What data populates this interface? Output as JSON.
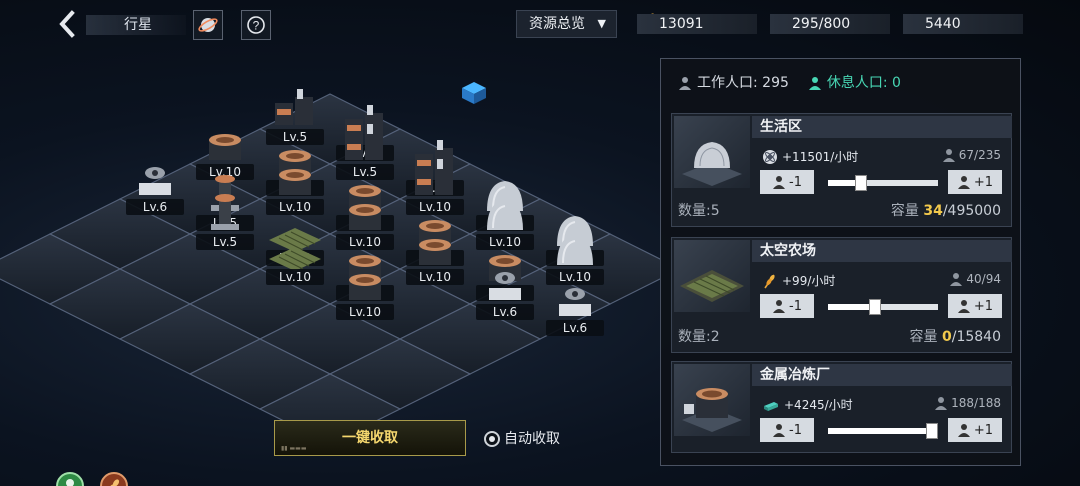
{
  "header": {
    "planet_title": "行星",
    "resources_overview": "资源总览",
    "resources": [
      {
        "name": "energy",
        "icon": "wheat-icon",
        "value": "13091"
      },
      {
        "name": "population",
        "icon": "population-icon",
        "value": "295/800"
      },
      {
        "name": "metal",
        "icon": "metal-bars-icon",
        "value": "5440"
      }
    ]
  },
  "map": {
    "collect_all_label": "一键收取",
    "auto_collect_label": "自动收取",
    "buildings": [
      {
        "type": "factory",
        "level": "Lv.5"
      },
      {
        "type": "factory",
        "level": "Lv.5"
      },
      {
        "type": "factory",
        "level": "Lv.5"
      },
      {
        "type": "factory",
        "level": "Lv.10"
      },
      {
        "type": "factory",
        "level": "Lv.10"
      },
      {
        "type": "dome",
        "level": "Lv.10"
      },
      {
        "type": "dome",
        "level": "Lv.10"
      },
      {
        "type": "dome",
        "level": "Lv.10"
      },
      {
        "type": "dome",
        "level": "Lv.10"
      },
      {
        "type": "dome",
        "level": "Lv.10"
      },
      {
        "type": "smelter",
        "level": "Lv.10"
      },
      {
        "type": "smelter",
        "level": "Lv.10"
      },
      {
        "type": "smelter",
        "level": "Lv.10"
      },
      {
        "type": "smelter",
        "level": "Lv.10"
      },
      {
        "type": "smelter",
        "level": "Lv.10"
      },
      {
        "type": "smelter",
        "level": "Lv.10"
      },
      {
        "type": "smelter",
        "level": "Lv.10"
      },
      {
        "type": "smelter",
        "level": "Lv.10"
      },
      {
        "type": "radar",
        "level": "Lv.6"
      },
      {
        "type": "radar",
        "level": "Lv.6"
      },
      {
        "type": "radar",
        "level": "Lv.6"
      },
      {
        "type": "tower",
        "level": "Lv.5"
      },
      {
        "type": "tower",
        "level": "Lv.5"
      },
      {
        "type": "farm",
        "level": "Lv.10"
      },
      {
        "type": "farm",
        "level": "Lv.10"
      },
      {
        "type": "smelter",
        "level": "Lv.10"
      },
      {
        "type": "smelter",
        "level": "Lv.10"
      }
    ]
  },
  "panel": {
    "work_pop_label": "工作人口: 295",
    "rest_pop_label": "休息人口: 0",
    "cards": [
      {
        "title": "生活区",
        "rate": "+11501/小时",
        "rate_icon": "atom-icon",
        "people": "67/235",
        "minus": "-1",
        "plus": "+1",
        "slider_fraction": 0.3,
        "qty": "数量:5",
        "storage_label": "容量 ",
        "storage_current": "34",
        "storage_max": "/495000"
      },
      {
        "title": "太空农场",
        "rate": "+99/小时",
        "rate_icon": "wheat-icon",
        "people": "40/94",
        "minus": "-1",
        "plus": "+1",
        "slider_fraction": 0.43,
        "qty": "数量:2",
        "storage_label": "容量 ",
        "storage_current": "0",
        "storage_max": "/15840"
      },
      {
        "title": "金属冶炼厂",
        "rate": "+4245/小时",
        "rate_icon": "metal-bars-icon",
        "people": "188/188",
        "minus": "-1",
        "plus": "+1",
        "slider_fraction": 1.0
      }
    ]
  },
  "colors": {
    "accent_gold": "#f2c94c",
    "rest_green": "#48d7b4",
    "panel_bg": "#0e1218"
  }
}
